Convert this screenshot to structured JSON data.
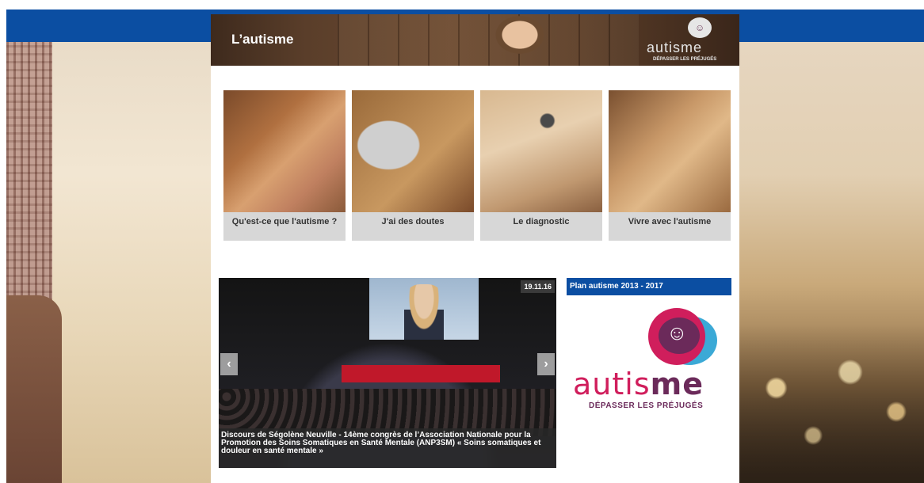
{
  "banner": {
    "title": "L’autisme",
    "logo_word": "autisme",
    "logo_tagline": "DÉPASSER LES PRÉJUGÉS"
  },
  "tiles": [
    {
      "label": "Qu'est-ce que l'autisme ?"
    },
    {
      "label": "J'ai des doutes"
    },
    {
      "label": "Le diagnostic"
    },
    {
      "label": "Vivre avec l'autisme"
    }
  ],
  "slider": {
    "date": "19.11.16",
    "caption": "Discours de Ségolène Neuville - 14ème congrès de l’Association Nationale pour la Promotion des Soins Somatiques en Santé Mentale (ANP3SM) « Soins somatiques et douleur en santé mentale »",
    "prev_icon": "chevron-left-icon",
    "next_icon": "chevron-right-icon"
  },
  "sidebar": {
    "header": "Plan autisme 2013 - 2017",
    "logo_word_1": "autis",
    "logo_word_2": "me",
    "logo_tagline": "DÉPASSER LES PRÉJUGÉS"
  },
  "colors": {
    "topbar": "#0b4ea2",
    "logo_pink": "#d01e5c",
    "logo_purple": "#6b2a5a",
    "logo_blue": "#3ba9d6"
  }
}
